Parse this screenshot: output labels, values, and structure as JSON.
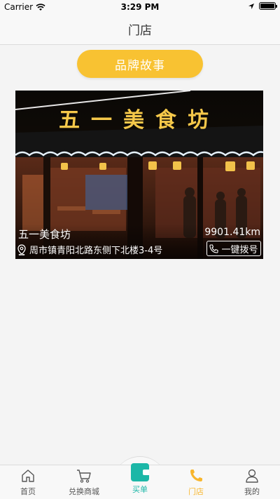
{
  "status_bar": {
    "carrier": "Carrier",
    "time": "3:29 PM"
  },
  "nav": {
    "title": "门店"
  },
  "brand_button": {
    "label": "品牌故事"
  },
  "store": {
    "sign_text": "五一美食坊",
    "name": "五一美食坊",
    "distance": "9901.41km",
    "address": "周市镇青阳北路东侧下北楼3-4号",
    "call_label": "一键拨号"
  },
  "tabs": [
    {
      "label": "首页",
      "icon": "home-icon"
    },
    {
      "label": "兑换商城",
      "icon": "cart-icon"
    },
    {
      "label": "买单",
      "icon": "wallet-icon"
    },
    {
      "label": "门店",
      "icon": "phone-icon"
    },
    {
      "label": "我的",
      "icon": "person-icon"
    }
  ],
  "colors": {
    "accent": "#f8c232",
    "active_tab": "#f8b62d",
    "pay_teal": "#1cb7a7"
  }
}
